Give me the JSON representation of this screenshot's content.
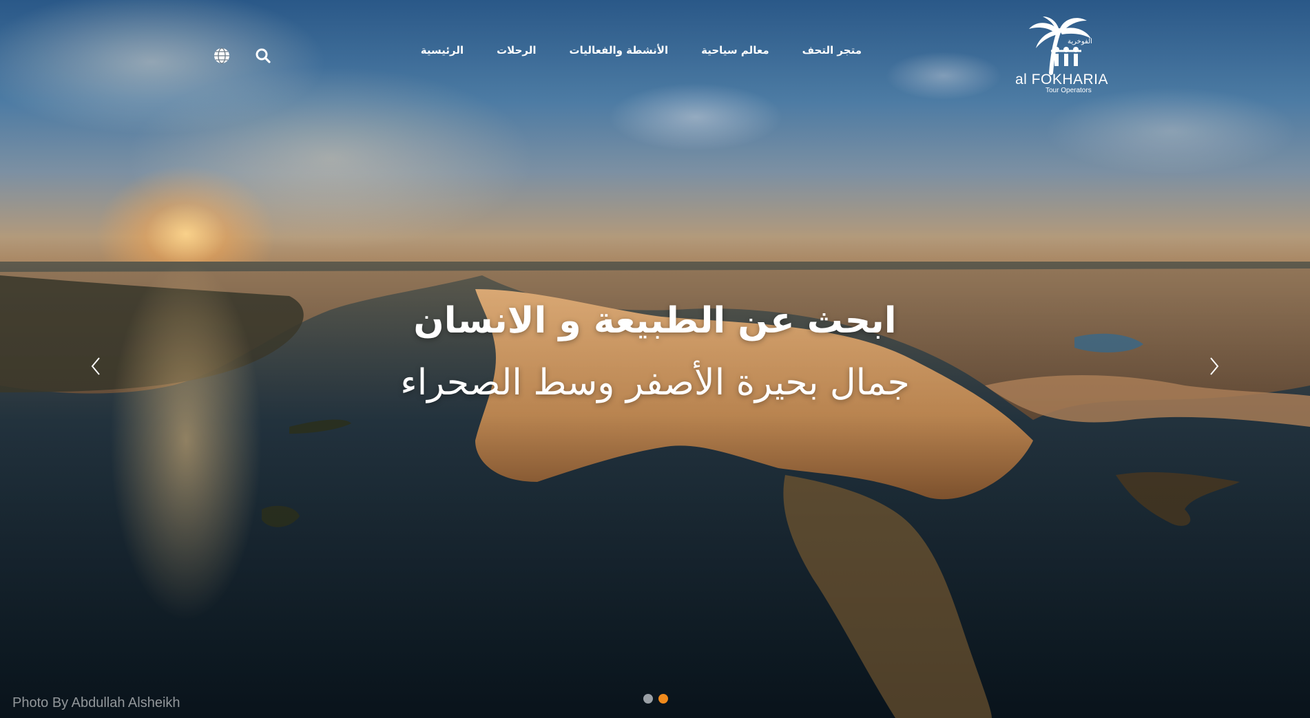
{
  "logo": {
    "name_latin": "al FOKHARIA",
    "tagline": "Tour Operators",
    "name_arabic": "الفوخرية"
  },
  "nav": {
    "items": [
      {
        "label": "الرئيسية"
      },
      {
        "label": "الرحلات"
      },
      {
        "label": "الأنشطة والفعاليات"
      },
      {
        "label": "معالم سياحية"
      },
      {
        "label": "متجر التحف"
      }
    ]
  },
  "icons": {
    "search": "search-icon",
    "language": "globe-icon",
    "prev": "chevron-left-icon",
    "next": "chevron-right-icon"
  },
  "slide": {
    "headline": "ابحث عن الطبيعة و الانسان",
    "subline": "جمال بحيرة الأصفر وسط الصحراء",
    "credit": "Photo By Abdullah Alsheikh"
  },
  "carousel": {
    "slide_count": 2,
    "active_index": 1
  },
  "colors": {
    "dot_inactive": "#9aa0a6",
    "dot_active": "#f08a1c",
    "text": "#ffffff"
  }
}
